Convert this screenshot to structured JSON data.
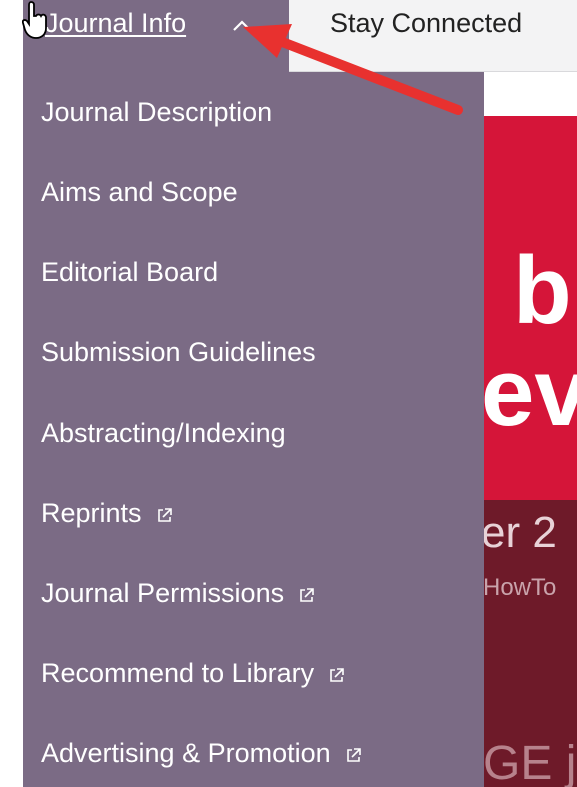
{
  "nav": {
    "active_tab": "Journal Info",
    "next_tab": "Stay Connected"
  },
  "menu": {
    "items": [
      {
        "label": "Journal Description",
        "external": false
      },
      {
        "label": "Aims and Scope",
        "external": false
      },
      {
        "label": "Editorial Board",
        "external": false
      },
      {
        "label": "Submission Guidelines",
        "external": false
      },
      {
        "label": "Abstracting/Indexing",
        "external": false
      },
      {
        "label": "Reprints",
        "external": true
      },
      {
        "label": "Journal Permissions",
        "external": true
      },
      {
        "label": "Recommend to Library",
        "external": true
      },
      {
        "label": "Advertising & Promotion",
        "external": true
      }
    ]
  },
  "hero": {
    "fragment_1": "b",
    "fragment_2": "ev",
    "fragment_3": "er 2",
    "fragment_4": "HowTo",
    "fragment_5": "GE jo"
  },
  "colors": {
    "menu_bg": "#7b6b85",
    "hero_red": "#d51539",
    "arrow_red": "#e8312f"
  },
  "icons": {
    "chevron": "chevron-up-icon",
    "external": "external-link-icon",
    "cursor": "hand-cursor-icon"
  }
}
